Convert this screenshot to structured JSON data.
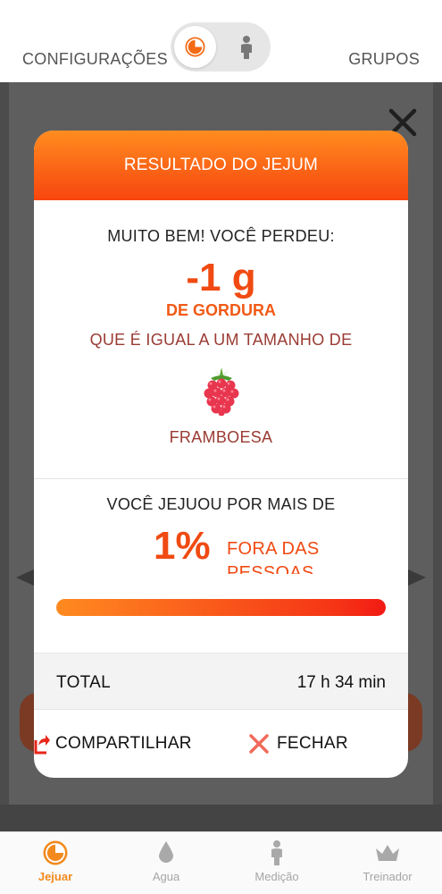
{
  "header": {
    "left_link": "CONFIGURAÇÕES",
    "right_link": "GRUPOS",
    "toggle": {
      "active": "fasting-icon",
      "inactive": "person-icon"
    }
  },
  "modal": {
    "title": "RESULTADO DO JEJUM",
    "result": {
      "intro": "MUITO BEM! VOCÊ PERDEU:",
      "value": "-1 g",
      "unit": "DE GORDURA",
      "comparison": "QUE É IGUAL A UM TAMANHO DE",
      "fruit_icon": "raspberry-icon",
      "fruit_name": "FRAMBOESA"
    },
    "ranking": {
      "intro": "VOCÊ JEJUOU POR MAIS DE",
      "percent": "1%",
      "label": "FORA DAS PESSOAS",
      "bar_fill": 1.0
    },
    "total": {
      "label": "TOTAL",
      "value": "17 h 34 min"
    },
    "actions": {
      "share": "COMPARTILHAR",
      "close": "FECHAR"
    }
  },
  "tabs": [
    {
      "label": "Jejuar",
      "icon": "fasting-icon",
      "active": true
    },
    {
      "label": "Agua",
      "icon": "water-drop-icon",
      "active": false
    },
    {
      "label": "Medição",
      "icon": "person-icon",
      "active": false
    },
    {
      "label": "Treinador",
      "icon": "crown-icon",
      "active": false
    }
  ],
  "colors": {
    "accent": "#f04a12",
    "accent_light": "#ff8c1f",
    "fruit_text": "#9a3b33",
    "tab_active": "#f28a1e"
  }
}
